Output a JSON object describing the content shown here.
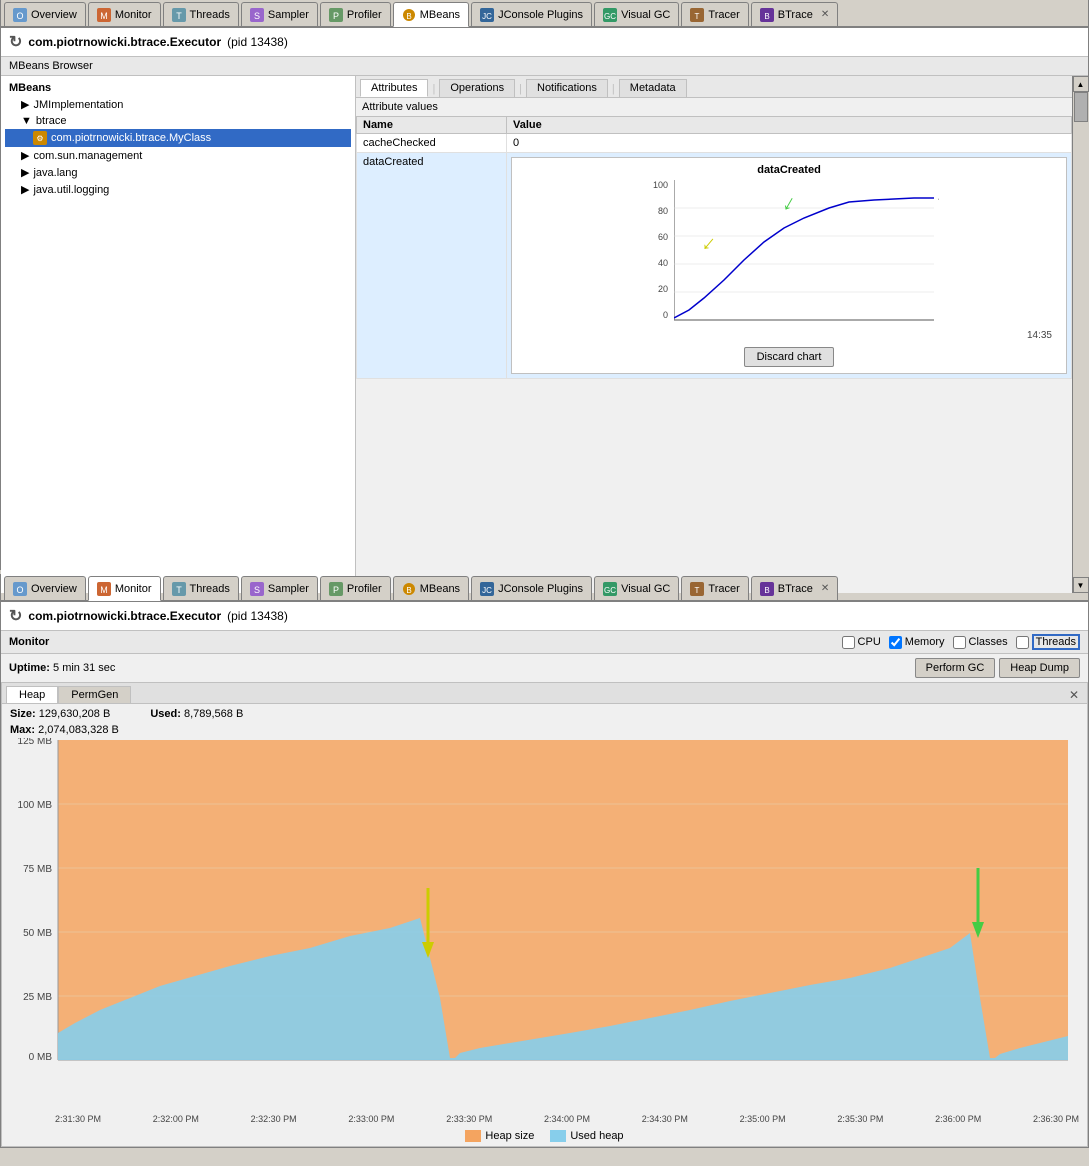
{
  "window1": {
    "tabs": [
      {
        "label": "Overview",
        "icon": "overview",
        "active": false
      },
      {
        "label": "Monitor",
        "icon": "monitor",
        "active": false
      },
      {
        "label": "Threads",
        "icon": "threads",
        "active": false
      },
      {
        "label": "Sampler",
        "icon": "sampler",
        "active": false
      },
      {
        "label": "Profiler",
        "icon": "profiler",
        "active": false
      },
      {
        "label": "MBeans",
        "icon": "mbeans",
        "active": true
      },
      {
        "label": "JConsole Plugins",
        "icon": "jconsole",
        "active": false
      },
      {
        "label": "Visual GC",
        "icon": "visualgc",
        "active": false
      },
      {
        "label": "Tracer",
        "icon": "tracer",
        "active": false
      },
      {
        "label": "BTrace",
        "icon": "btrace",
        "active": false
      }
    ],
    "title": "com.piotrnowicki.btrace.Executor",
    "pid": "(pid 13438)",
    "subtitle": "MBeans Browser",
    "mbeans": {
      "header": "MBeans",
      "items": [
        {
          "label": "JMImplementation",
          "level": 1,
          "type": "parent",
          "expanded": false
        },
        {
          "label": "btrace",
          "level": 1,
          "type": "parent",
          "expanded": true
        },
        {
          "label": "com.piotrnowicki.btrace.MyClass",
          "level": 2,
          "type": "bean",
          "selected": true
        },
        {
          "label": "com.sun.management",
          "level": 1,
          "type": "parent",
          "expanded": false
        },
        {
          "label": "java.lang",
          "level": 1,
          "type": "parent",
          "expanded": false
        },
        {
          "label": "java.util.logging",
          "level": 1,
          "type": "parent",
          "expanded": false
        }
      ]
    },
    "attr_tabs": [
      "Attributes",
      "Operations",
      "Notifications",
      "Metadata"
    ],
    "active_attr_tab": "Attributes",
    "attr_values_label": "Attribute values",
    "table": {
      "headers": [
        "Name",
        "Value"
      ],
      "rows": [
        {
          "name": "cacheChecked",
          "value": "0"
        },
        {
          "name": "dataCreated",
          "value": ""
        }
      ]
    },
    "chart": {
      "title": "dataCreated",
      "value_label": "93",
      "time_label": "14:35",
      "y_labels": [
        "100",
        "80",
        "60",
        "40",
        "20",
        "0"
      ]
    },
    "discard_btn": "Discard chart"
  },
  "window2": {
    "tabs": [
      {
        "label": "Overview",
        "icon": "overview",
        "active": false
      },
      {
        "label": "Monitor",
        "icon": "monitor",
        "active": true
      },
      {
        "label": "Threads",
        "icon": "threads",
        "active": false
      },
      {
        "label": "Sampler",
        "icon": "sampler",
        "active": false
      },
      {
        "label": "Profiler",
        "icon": "profiler",
        "active": false
      },
      {
        "label": "MBeans",
        "icon": "mbeans",
        "active": false
      },
      {
        "label": "JConsole Plugins",
        "icon": "jconsole",
        "active": false
      },
      {
        "label": "Visual GC",
        "icon": "visualgc",
        "active": false
      },
      {
        "label": "Tracer",
        "icon": "tracer",
        "active": false
      },
      {
        "label": "BTrace",
        "icon": "btrace",
        "active": false
      }
    ],
    "title": "com.piotrnowicki.btrace.Executor",
    "pid": "(pid 13438)",
    "subtitle": "Monitor",
    "checkboxes": [
      {
        "label": "CPU",
        "checked": false
      },
      {
        "label": "Memory",
        "checked": true
      },
      {
        "label": "Classes",
        "checked": false
      },
      {
        "label": "Threads",
        "checked": false,
        "highlighted": true
      }
    ],
    "uptime_label": "Uptime:",
    "uptime_value": "5 min 31 sec",
    "perform_gc_btn": "Perform GC",
    "heap_dump_btn": "Heap Dump",
    "heap_tabs": [
      "Heap",
      "PermGen"
    ],
    "active_heap_tab": "Heap",
    "stats": {
      "size_label": "Size:",
      "size_value": "129,630,208 B",
      "used_label": "Used:",
      "used_value": "8,789,568 B",
      "max_label": "Max:",
      "max_value": "2,074,083,328 B"
    },
    "heap_chart": {
      "y_labels": [
        "125 MB",
        "100 MB",
        "75 MB",
        "50 MB",
        "25 MB",
        "0 MB"
      ],
      "x_labels": [
        "2:31:30 PM",
        "2:32:00 PM",
        "2:32:30 PM",
        "2:33:00 PM",
        "2:33:30 PM",
        "2:34:00 PM",
        "2:34:30 PM",
        "2:35:00 PM",
        "2:35:30 PM",
        "2:36:00 PM",
        "2:36:30 PM"
      ]
    },
    "legend": [
      {
        "label": "Heap size",
        "color": "heap-size"
      },
      {
        "label": "Used heap",
        "color": "used-heap"
      }
    ]
  }
}
